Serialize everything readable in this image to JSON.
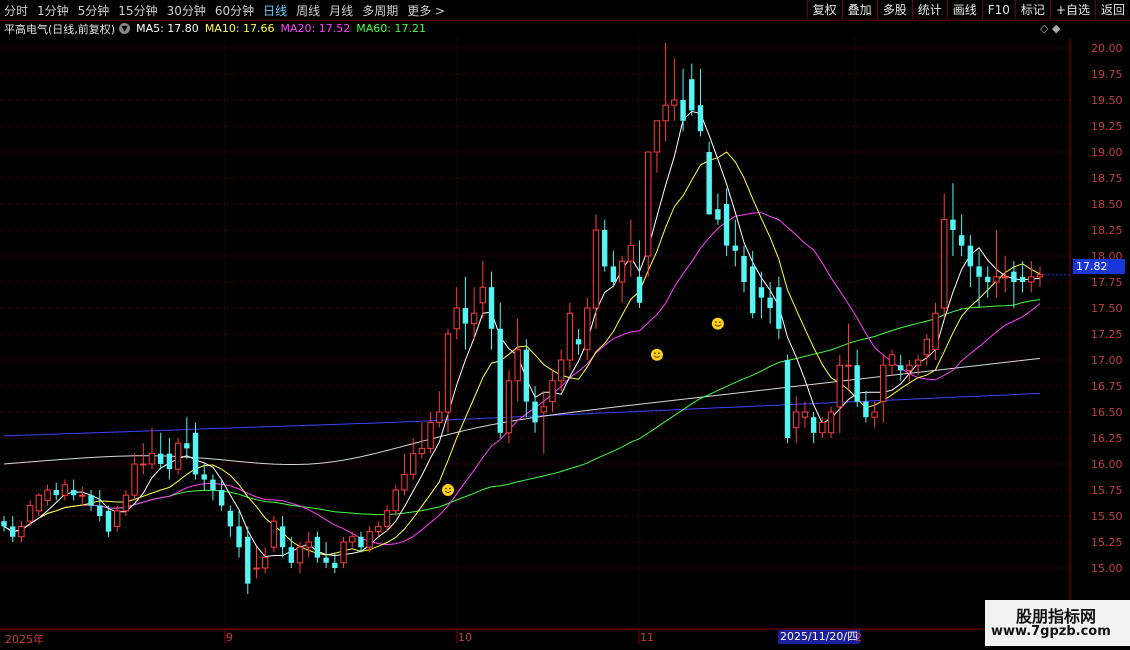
{
  "toolbar": {
    "periods": [
      "分时",
      "1分钟",
      "5分钟",
      "15分钟",
      "30分钟",
      "60分钟",
      "日线",
      "周线",
      "月线",
      "多周期",
      "更多 >"
    ],
    "active_period": "日线",
    "actions": [
      "复权",
      "叠加",
      "多股",
      "统计",
      "画线",
      "F10",
      "标记",
      "+自选",
      "返回"
    ]
  },
  "legend": {
    "stock": "平高电气(日线,前复权)",
    "ma5": "MA5: 17.80",
    "ma10": "MA10: 17.66",
    "ma20": "MA20: 17.52",
    "ma60": "MA60: 17.21"
  },
  "top_controls": "◇ ◆",
  "price_axis": {
    "ticks": [
      "20.00",
      "19.75",
      "19.50",
      "19.25",
      "19.00",
      "18.75",
      "18.50",
      "18.25",
      "18.00",
      "17.75",
      "17.50",
      "17.25",
      "17.00",
      "16.75",
      "16.50",
      "16.25",
      "16.00",
      "15.75",
      "15.50",
      "15.25",
      "15.00"
    ],
    "current_price": "17.82"
  },
  "time_axis": {
    "labels": [
      "2025年",
      "9",
      "10",
      "11",
      "2"
    ],
    "cursor_date": "2025/11/20/四"
  },
  "colors": {
    "up": "#ff3c3c",
    "down": "#54f5f5",
    "ma5": "#ffffff",
    "ma10": "#ffff40",
    "ma20": "#ff40ff",
    "ma60": "#40ff40",
    "ma_slow": "#d9d9d9",
    "ma_slower": "#4040ff",
    "grid": "#6a0000"
  },
  "watermark": {
    "cn": "股朋指标网",
    "url": "www.7gpzb.com"
  },
  "chart_data": {
    "type": "candlestick",
    "ylim": [
      14.75,
      20.1
    ],
    "candles": [
      [
        15.45,
        15.5,
        15.35,
        15.4
      ],
      [
        15.4,
        15.5,
        15.25,
        15.3
      ],
      [
        15.3,
        15.45,
        15.25,
        15.4
      ],
      [
        15.45,
        15.65,
        15.4,
        15.6
      ],
      [
        15.55,
        15.72,
        15.5,
        15.7
      ],
      [
        15.65,
        15.8,
        15.6,
        15.75
      ],
      [
        15.75,
        15.82,
        15.65,
        15.7
      ],
      [
        15.7,
        15.85,
        15.65,
        15.8
      ],
      [
        15.75,
        15.85,
        15.65,
        15.7
      ],
      [
        15.7,
        15.78,
        15.6,
        15.7
      ],
      [
        15.7,
        15.75,
        15.55,
        15.6
      ],
      [
        15.6,
        15.75,
        15.45,
        15.5
      ],
      [
        15.55,
        15.6,
        15.3,
        15.35
      ],
      [
        15.4,
        15.6,
        15.35,
        15.55
      ],
      [
        15.55,
        15.75,
        15.5,
        15.7
      ],
      [
        15.7,
        16.1,
        15.65,
        16.0
      ],
      [
        16.0,
        16.2,
        15.9,
        16.0
      ],
      [
        16.0,
        16.35,
        15.95,
        16.1
      ],
      [
        16.1,
        16.3,
        15.95,
        16.0
      ],
      [
        16.1,
        16.25,
        15.85,
        15.95
      ],
      [
        15.95,
        16.25,
        15.9,
        16.2
      ],
      [
        16.2,
        16.45,
        16.05,
        16.15
      ],
      [
        16.3,
        16.4,
        15.85,
        15.9
      ],
      [
        15.9,
        16.0,
        15.75,
        15.85
      ],
      [
        15.85,
        15.9,
        15.65,
        15.75
      ],
      [
        15.75,
        15.85,
        15.55,
        15.6
      ],
      [
        15.55,
        15.6,
        15.3,
        15.4
      ],
      [
        15.4,
        15.55,
        15.1,
        15.2
      ],
      [
        15.3,
        15.4,
        14.75,
        14.85
      ],
      [
        15.0,
        15.2,
        14.9,
        15.0
      ],
      [
        15.0,
        15.2,
        14.95,
        15.1
      ],
      [
        15.2,
        15.5,
        15.15,
        15.45
      ],
      [
        15.4,
        15.5,
        15.1,
        15.2
      ],
      [
        15.2,
        15.3,
        15.0,
        15.05
      ],
      [
        15.05,
        15.25,
        14.95,
        15.2
      ],
      [
        15.2,
        15.35,
        15.1,
        15.25
      ],
      [
        15.3,
        15.35,
        15.05,
        15.1
      ],
      [
        15.1,
        15.25,
        15.0,
        15.05
      ],
      [
        15.05,
        15.15,
        14.95,
        15.0
      ],
      [
        15.05,
        15.3,
        15.0,
        15.25
      ],
      [
        15.25,
        15.35,
        15.2,
        15.3
      ],
      [
        15.3,
        15.35,
        15.15,
        15.2
      ],
      [
        15.2,
        15.4,
        15.15,
        15.35
      ],
      [
        15.35,
        15.45,
        15.3,
        15.4
      ],
      [
        15.4,
        15.6,
        15.35,
        15.55
      ],
      [
        15.55,
        15.8,
        15.5,
        15.75
      ],
      [
        15.75,
        16.1,
        15.7,
        15.9
      ],
      [
        15.9,
        16.25,
        15.85,
        16.1
      ],
      [
        16.1,
        16.4,
        16.05,
        16.15
      ],
      [
        16.15,
        16.5,
        16.1,
        16.4
      ],
      [
        16.4,
        16.7,
        16.35,
        16.5
      ],
      [
        16.5,
        17.3,
        16.3,
        17.25
      ],
      [
        17.3,
        17.7,
        17.2,
        17.5
      ],
      [
        17.5,
        17.8,
        17.1,
        17.35
      ],
      [
        17.35,
        17.7,
        17.2,
        17.45
      ],
      [
        17.55,
        17.95,
        17.4,
        17.7
      ],
      [
        17.7,
        17.85,
        17.1,
        17.3
      ],
      [
        17.3,
        17.55,
        16.25,
        16.3
      ],
      [
        16.3,
        16.9,
        16.2,
        16.8
      ],
      [
        16.8,
        17.4,
        16.6,
        17.1
      ],
      [
        17.1,
        17.2,
        16.45,
        16.6
      ],
      [
        16.6,
        16.75,
        16.3,
        16.4
      ],
      [
        16.5,
        16.7,
        16.1,
        16.55
      ],
      [
        16.6,
        16.9,
        16.5,
        16.8
      ],
      [
        16.8,
        17.1,
        16.7,
        17.0
      ],
      [
        17.0,
        17.55,
        16.9,
        17.45
      ],
      [
        17.2,
        17.3,
        17.05,
        17.15
      ],
      [
        17.1,
        17.6,
        17.0,
        17.5
      ],
      [
        17.5,
        18.4,
        17.3,
        18.25
      ],
      [
        18.25,
        18.35,
        17.85,
        17.9
      ],
      [
        17.9,
        18.05,
        17.7,
        17.75
      ],
      [
        17.75,
        18.0,
        17.55,
        17.95
      ],
      [
        17.95,
        18.35,
        17.8,
        18.1
      ],
      [
        17.8,
        18.15,
        17.5,
        17.55
      ],
      [
        18.0,
        19.0,
        17.8,
        19.0
      ],
      [
        19.0,
        19.3,
        18.8,
        19.3
      ],
      [
        19.3,
        20.05,
        19.1,
        19.45
      ],
      [
        19.45,
        19.9,
        19.3,
        19.5
      ],
      [
        19.5,
        19.8,
        19.2,
        19.3
      ],
      [
        19.7,
        19.85,
        19.35,
        19.4
      ],
      [
        19.45,
        19.8,
        19.15,
        19.2
      ],
      [
        19.0,
        19.1,
        18.4,
        18.4
      ],
      [
        18.45,
        18.6,
        18.3,
        18.35
      ],
      [
        18.5,
        18.65,
        18.0,
        18.1
      ],
      [
        18.1,
        18.35,
        17.9,
        18.05
      ],
      [
        18.0,
        18.1,
        17.65,
        17.75
      ],
      [
        17.9,
        18.05,
        17.4,
        17.45
      ],
      [
        17.7,
        17.85,
        17.4,
        17.6
      ],
      [
        17.6,
        17.75,
        17.35,
        17.5
      ],
      [
        17.7,
        17.8,
        17.2,
        17.3
      ],
      [
        17.0,
        17.05,
        16.2,
        16.25
      ],
      [
        16.35,
        16.65,
        16.2,
        16.5
      ],
      [
        16.45,
        16.6,
        16.35,
        16.5
      ],
      [
        16.45,
        16.5,
        16.2,
        16.3
      ],
      [
        16.3,
        16.45,
        16.25,
        16.4
      ],
      [
        16.3,
        16.55,
        16.25,
        16.5
      ],
      [
        16.55,
        17.05,
        16.3,
        16.95
      ],
      [
        16.95,
        17.35,
        16.7,
        16.95
      ],
      [
        16.95,
        17.1,
        16.55,
        16.6
      ],
      [
        16.6,
        16.7,
        16.4,
        16.45
      ],
      [
        16.45,
        16.6,
        16.35,
        16.5
      ],
      [
        16.6,
        17.05,
        16.4,
        16.95
      ],
      [
        16.95,
        17.1,
        16.85,
        17.05
      ],
      [
        16.95,
        17.05,
        16.8,
        16.9
      ],
      [
        16.9,
        17.0,
        16.8,
        16.95
      ],
      [
        16.95,
        17.05,
        16.85,
        17.0
      ],
      [
        17.05,
        17.25,
        16.95,
        17.2
      ],
      [
        17.1,
        17.55,
        17.0,
        17.45
      ],
      [
        17.5,
        18.6,
        17.4,
        18.35
      ],
      [
        18.35,
        18.7,
        18.0,
        18.25
      ],
      [
        18.2,
        18.4,
        18.0,
        18.1
      ],
      [
        18.1,
        18.2,
        17.7,
        17.9
      ],
      [
        17.9,
        18.05,
        17.5,
        17.8
      ],
      [
        17.8,
        17.9,
        17.6,
        17.75
      ],
      [
        17.75,
        18.25,
        17.6,
        17.8
      ],
      [
        17.8,
        18.0,
        17.65,
        17.8
      ],
      [
        17.85,
        17.95,
        17.5,
        17.75
      ],
      [
        17.8,
        17.95,
        17.65,
        17.75
      ],
      [
        17.75,
        17.95,
        17.65,
        17.8
      ],
      [
        17.8,
        17.9,
        17.7,
        17.82
      ]
    ],
    "markers": [
      {
        "index": 51,
        "value": 15.75
      },
      {
        "index": 75,
        "value": 17.05
      },
      {
        "index": 82,
        "value": 17.35
      }
    ]
  }
}
